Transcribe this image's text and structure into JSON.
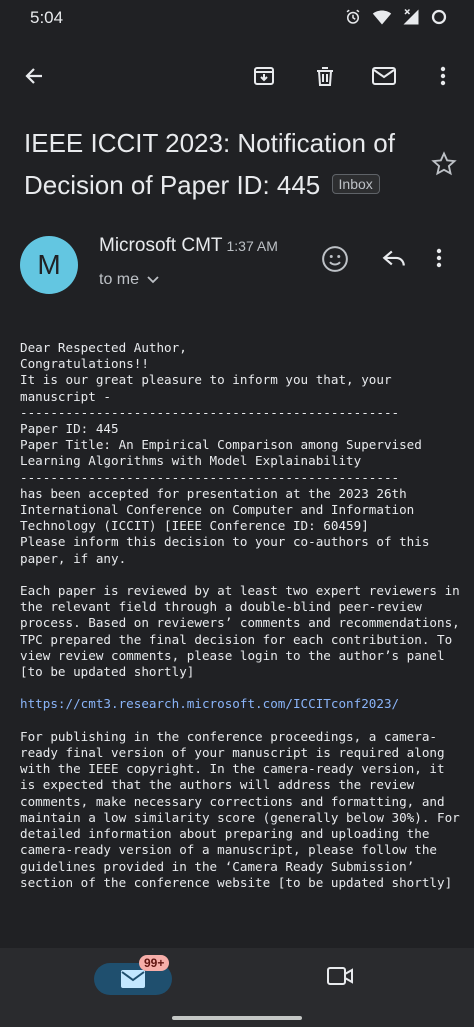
{
  "status": {
    "time": "5:04"
  },
  "email": {
    "subject": "IEEE ICCIT 2023: Notification of Decision of Paper ID: 445",
    "label": "Inbox",
    "sender": "Microsoft CMT",
    "avatar_letter": "M",
    "time": "1:37 AM",
    "recipient": "to me",
    "body_before_link": "Dear Respected Author,\nCongratulations!!\nIt is our great pleasure to inform you that, your manuscript -\n--------------------------------------------------\nPaper ID: 445\nPaper Title: An Empirical Comparison among Supervised Learning Algorithms with Model Explainability\n--------------------------------------------------\nhas been accepted for presentation at the 2023 26th International Conference on Computer and Information Technology (ICCIT) [IEEE Conference ID: 60459]\nPlease inform this decision to your co-authors of this paper, if any.\n\nEach paper is reviewed by at least two expert reviewers in the relevant field through a double-blind peer-review process. Based on reviewers’ comments and recommendations, TPC prepared the final decision for each contribution. To view review comments, please login to the author’s panel [to be updated shortly]\n\n",
    "link": "https://cmt3.research.microsoft.com/ICCITconf2023/",
    "body_after_link": "\n\nFor publishing in the conference proceedings, a camera-ready final version of your manuscript is required along with the IEEE copyright. In the camera-ready version, it is expected that the authors will address the review comments, make necessary corrections and formatting, and maintain a low similarity score (generally below 30%). For detailed information about preparing and uploading the camera-ready version of a manuscript, please follow the guidelines provided in the ‘Camera Ready Submission’ section of the conference website [to be updated shortly]"
  },
  "bottom_nav": {
    "mail_badge": "99+"
  },
  "icons": {
    "back": "arrow-back-icon",
    "archive": "archive-icon",
    "delete": "trash-icon",
    "mark_unread": "mail-icon",
    "more": "more-vert-icon",
    "star": "star-icon",
    "emoji": "emoji-icon",
    "reply": "reply-icon",
    "meet": "video-icon"
  },
  "colors": {
    "background": "#202124",
    "avatar": "#63c6e1",
    "link": "#8ab4f8",
    "badge": "#f6aea9",
    "mail_pill": "#1f4f6e"
  }
}
